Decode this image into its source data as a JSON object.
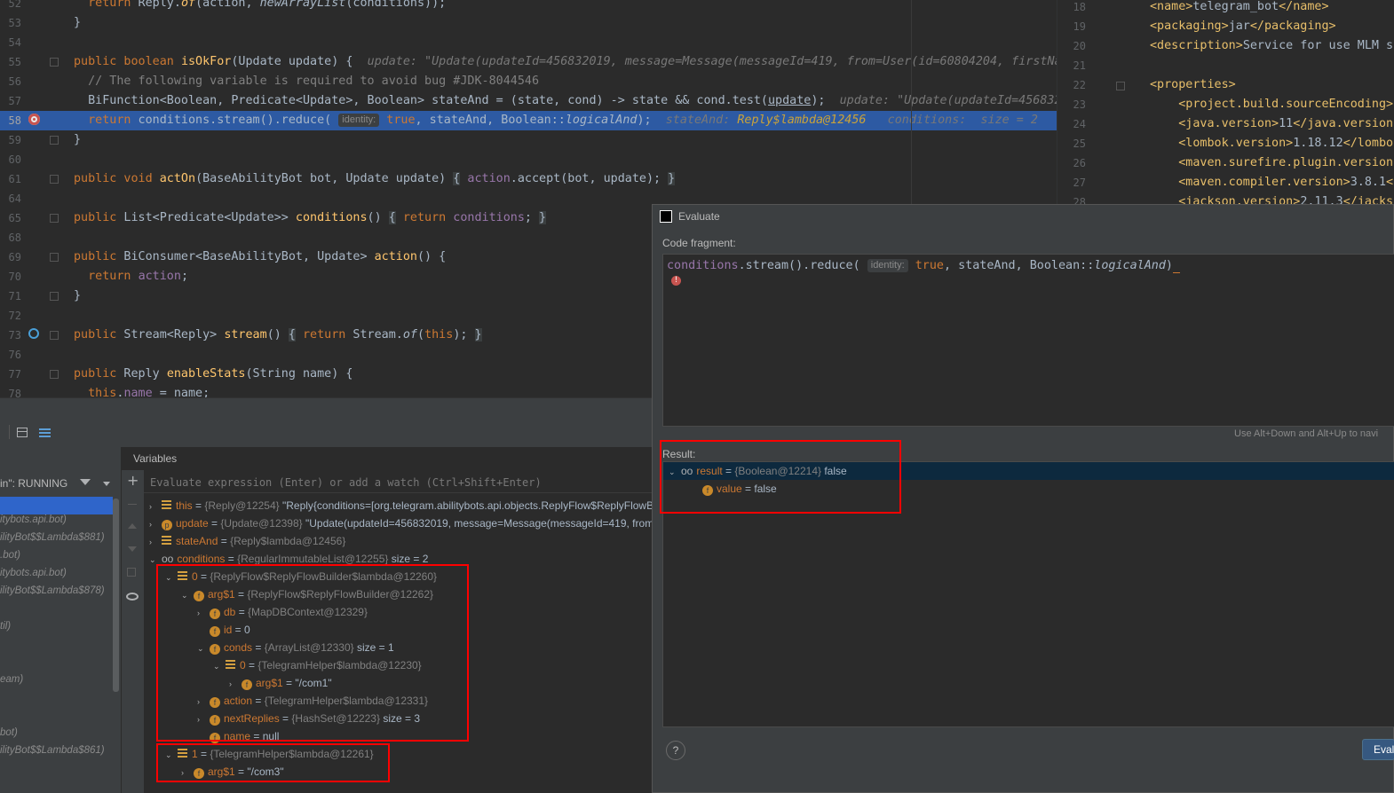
{
  "editor": {
    "lines": [
      {
        "n": "52",
        "html": "  <span class='kw'>return</span> Reply.<span class='it fn'>of</span>(action, <span class='it'>newArrayList</span>(conditions));"
      },
      {
        "n": "53",
        "html": "}"
      },
      {
        "n": "54",
        "html": ""
      },
      {
        "n": "55",
        "html": "<span class='kw'>public boolean</span> <span class='fn'>isOkFor</span>(Update update) {  <span class='hint'>update: \"Update(updateId=456832019, message=Message(messageId=419, from=User(id=60804204, firstNa</span>"
      },
      {
        "n": "56",
        "html": "  <span class='cm'>// The following variable is required to avoid bug #JDK-8044546</span>"
      },
      {
        "n": "57",
        "html": "  BiFunction&lt;Boolean, Predicate&lt;Update&gt;, Boolean&gt; stateAnd = (state, cond) -&gt; state &amp;&amp; cond.test(<u>update</u>);  <span class='hint'>update: \"Update(updateId=456832</span>"
      },
      {
        "n": "58",
        "html": "  <span class='kw'>return</span> conditions.stream().reduce( <span class='chip'>identity:</span> <span class='kw'>true</span>, stateAnd, Boolean::<span class='it'>logicalAnd</span>);  <span class='hint'>stateAnd: </span><span class='hint' style='color:#c9a23a'>Reply$lambda@12456</span><span class='hint'>   conditions:  size = 2</span>"
      },
      {
        "n": "59",
        "html": "}"
      },
      {
        "n": "60",
        "html": ""
      },
      {
        "n": "61",
        "html": "<span class='kw'>public void</span> <span class='fn'>actOn</span>(BaseAbilityBot bot, Update update) <span class='brk'>{</span> <span class='fld'>action</span>.accept(bot, update); <span class='brk'>}</span>"
      },
      {
        "n": "64",
        "html": ""
      },
      {
        "n": "65",
        "html": "<span class='kw'>public</span> List&lt;Predicate&lt;Update&gt;&gt; <span class='fn'>conditions</span>() <span class='brk'>{</span> <span class='kw'>return</span> <span class='fld'>conditions</span>; <span class='brk'>}</span>"
      },
      {
        "n": "68",
        "html": ""
      },
      {
        "n": "69",
        "html": "<span class='kw'>public</span> BiConsumer&lt;BaseAbilityBot, Update&gt; <span class='fn'>action</span>() {"
      },
      {
        "n": "70",
        "html": "  <span class='kw'>return</span> <span class='fld'>action</span>;"
      },
      {
        "n": "71",
        "html": "}"
      },
      {
        "n": "72",
        "html": ""
      },
      {
        "n": "73",
        "html": "<span class='kw'>public</span> Stream&lt;Reply&gt; <span class='fn'>stream</span>() <span class='brk'>{</span> <span class='kw'>return</span> Stream.<span class='it'>of</span>(<span class='kw'>this</span>); <span class='brk'>}</span>"
      },
      {
        "n": "76",
        "html": ""
      },
      {
        "n": "77",
        "html": "<span class='kw'>public</span> Reply <span class='fn'>enableStats</span>(String name) {"
      },
      {
        "n": "78",
        "html": "  <span class='kw'>this</span>.<span class='fld'>name</span> = name;"
      }
    ]
  },
  "xml": {
    "lines": [
      {
        "n": "18",
        "html": "<span class='tag'>&lt;name&gt;</span>telegram_bot<span class='tag'>&lt;/name&gt;</span>"
      },
      {
        "n": "19",
        "html": "<span class='tag'>&lt;packaging&gt;</span>jar<span class='tag'>&lt;/packaging&gt;</span>"
      },
      {
        "n": "20",
        "html": "<span class='tag'>&lt;description&gt;</span>Service for use MLM st"
      },
      {
        "n": "21",
        "html": ""
      },
      {
        "n": "22",
        "html": "<span class='tag'>&lt;properties&gt;</span>"
      },
      {
        "n": "23",
        "html": "    <span class='tag'>&lt;project.build.sourceEncoding&gt;</span>"
      },
      {
        "n": "24",
        "html": "    <span class='tag'>&lt;java.version&gt;</span>11<span class='tag'>&lt;/java.version</span>"
      },
      {
        "n": "25",
        "html": "    <span class='tag'>&lt;lombok.version&gt;</span>1.18.12<span class='tag'>&lt;/lombok</span>"
      },
      {
        "n": "26",
        "html": "    <span class='tag'>&lt;maven.surefire.plugin.version</span>"
      },
      {
        "n": "27",
        "html": "    <span class='tag'>&lt;maven.compiler.version&gt;</span>3.8.1<span class='tag'>&lt;</span>"
      },
      {
        "n": "28",
        "html": "    <span class='tag'>&lt;jackson.version&gt;</span>2.11.3<span class='tag'>&lt;/jacks</span>"
      }
    ]
  },
  "debug": {
    "thread_label": "in\": RUNNING",
    "variables_title": "Variables",
    "watch_placeholder": "Evaluate expression (Enter) or add a watch (Ctrl+Shift+Enter)",
    "frames": [
      "itybots.api.bot)",
      "ilityBot$$Lambda$881)",
      ".bot)",
      "itybots.api.bot)",
      "ilityBot$$Lambda$878)",
      "til)",
      "eam)",
      "bot)",
      "ilityBot$$Lambda$861)"
    ],
    "vars": [
      {
        "indent": 0,
        "arrow": "›",
        "icon": "list",
        "name": "this",
        "type": "{Reply@12254}",
        "value": "\"Reply{conditions=[org.telegram.abilitybots.api.objects.ReplyFlow$ReplyFlowB"
      },
      {
        "indent": 0,
        "arrow": "›",
        "icon": "p",
        "name": "update",
        "type": "{Update@12398}",
        "value": "\"Update(updateId=456832019, message=Message(messageId=419, from="
      },
      {
        "indent": 0,
        "arrow": "›",
        "icon": "list",
        "name": "stateAnd",
        "type": "{Reply$lambda@12456}",
        "value": ""
      },
      {
        "indent": 0,
        "arrow": "⌄",
        "icon": "oo",
        "name": "conditions",
        "type": "{RegularImmutableList@12255}",
        "value": "size = 2"
      },
      {
        "indent": 1,
        "arrow": "⌄",
        "icon": "list",
        "name": "0",
        "type": "{ReplyFlow$ReplyFlowBuilder$lambda@12260}",
        "value": ""
      },
      {
        "indent": 2,
        "arrow": "⌄",
        "icon": "f",
        "name": "arg$1",
        "type": "{ReplyFlow$ReplyFlowBuilder@12262}",
        "value": ""
      },
      {
        "indent": 3,
        "arrow": "›",
        "icon": "f",
        "name": "db",
        "type": "{MapDBContext@12329}",
        "value": ""
      },
      {
        "indent": 3,
        "arrow": "",
        "icon": "f",
        "name": "id",
        "type": "",
        "value": "0"
      },
      {
        "indent": 3,
        "arrow": "⌄",
        "icon": "f",
        "name": "conds",
        "type": "{ArrayList@12330}",
        "value": "size = 1"
      },
      {
        "indent": 4,
        "arrow": "⌄",
        "icon": "list",
        "name": "0",
        "type": "{TelegramHelper$lambda@12230}",
        "value": ""
      },
      {
        "indent": 5,
        "arrow": "›",
        "icon": "f",
        "name": "arg$1",
        "type": "",
        "value": "\"/com1\""
      },
      {
        "indent": 3,
        "arrow": "›",
        "icon": "f",
        "name": "action",
        "type": "{TelegramHelper$lambda@12331}",
        "value": ""
      },
      {
        "indent": 3,
        "arrow": "›",
        "icon": "f",
        "name": "nextReplies",
        "type": "{HashSet@12223}",
        "value": "size = 3"
      },
      {
        "indent": 3,
        "arrow": "",
        "icon": "f",
        "name": "name",
        "type": "",
        "value": "null"
      },
      {
        "indent": 1,
        "arrow": "⌄",
        "icon": "list",
        "name": "1",
        "type": "{TelegramHelper$lambda@12261}",
        "value": ""
      },
      {
        "indent": 2,
        "arrow": "›",
        "icon": "f",
        "name": "arg$1",
        "type": "",
        "value": "\"/com3\""
      }
    ]
  },
  "evaluate": {
    "title": "Evaluate",
    "code_fragment_label": "Code fragment:",
    "code_html": "<span class='fld'>conditions</span>.stream().reduce( <span class='chip'>identity:</span> <span class='kw'>true</span>, stateAnd, Boolean::<span class='it'>logicalAnd</span>)",
    "hint": "Use Alt+Down and Alt+Up to navi",
    "result_label": "Result:",
    "result": {
      "name": "result",
      "type": "{Boolean@12214}",
      "value": "false"
    },
    "child": {
      "name": "value",
      "value": "false"
    },
    "help_label": "?",
    "evaluate_button": "Eval"
  }
}
